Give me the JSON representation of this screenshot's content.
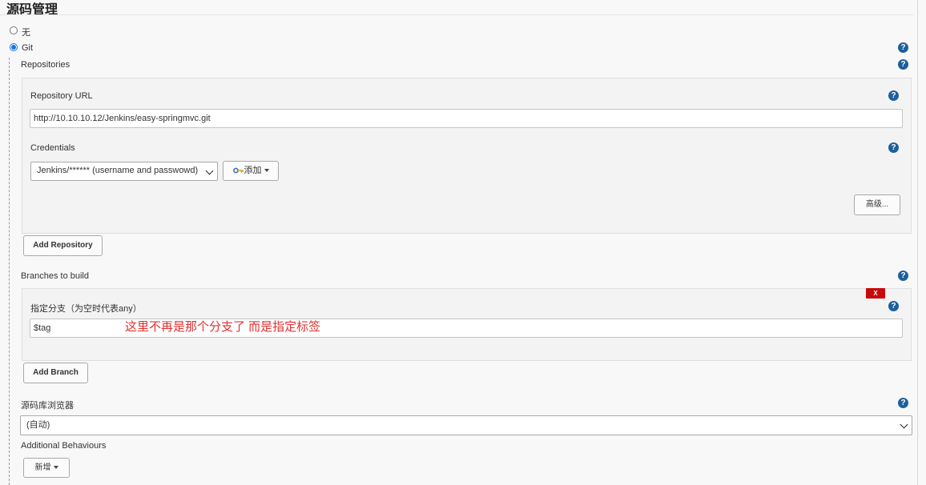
{
  "section": {
    "title": "源码管理"
  },
  "scm_options": [
    {
      "label": "无",
      "selected": false
    },
    {
      "label": "Git",
      "selected": true
    }
  ],
  "repositories": {
    "heading": "Repositories",
    "url_label": "Repository URL",
    "url_value": "http://10.10.10.12/Jenkins/easy-springmvc.git",
    "credentials_label": "Credentials",
    "credentials_value": "Jenkins/****** (username and passwowd)",
    "add_credentials_label": "添加",
    "advanced_label": "高级...",
    "add_repository_label": "Add Repository"
  },
  "branches": {
    "heading": "Branches to build",
    "delete_label": "X",
    "specifier_label": "指定分支（为空时代表any）",
    "specifier_value": "$tag",
    "annotation": "这里不再是那个分支了 而是指定标签",
    "add_branch_label": "Add Branch"
  },
  "browser": {
    "label": "源码库浏览器",
    "value": "(自动)"
  },
  "behaviours": {
    "label": "Additional Behaviours",
    "add_label": "新增"
  },
  "help_icon": {
    "glyph": "?",
    "color": "#1f5f9c"
  },
  "colors": {
    "accent": "#1a73e8",
    "delete": "#c90a0a",
    "annotation": "#e03030"
  }
}
